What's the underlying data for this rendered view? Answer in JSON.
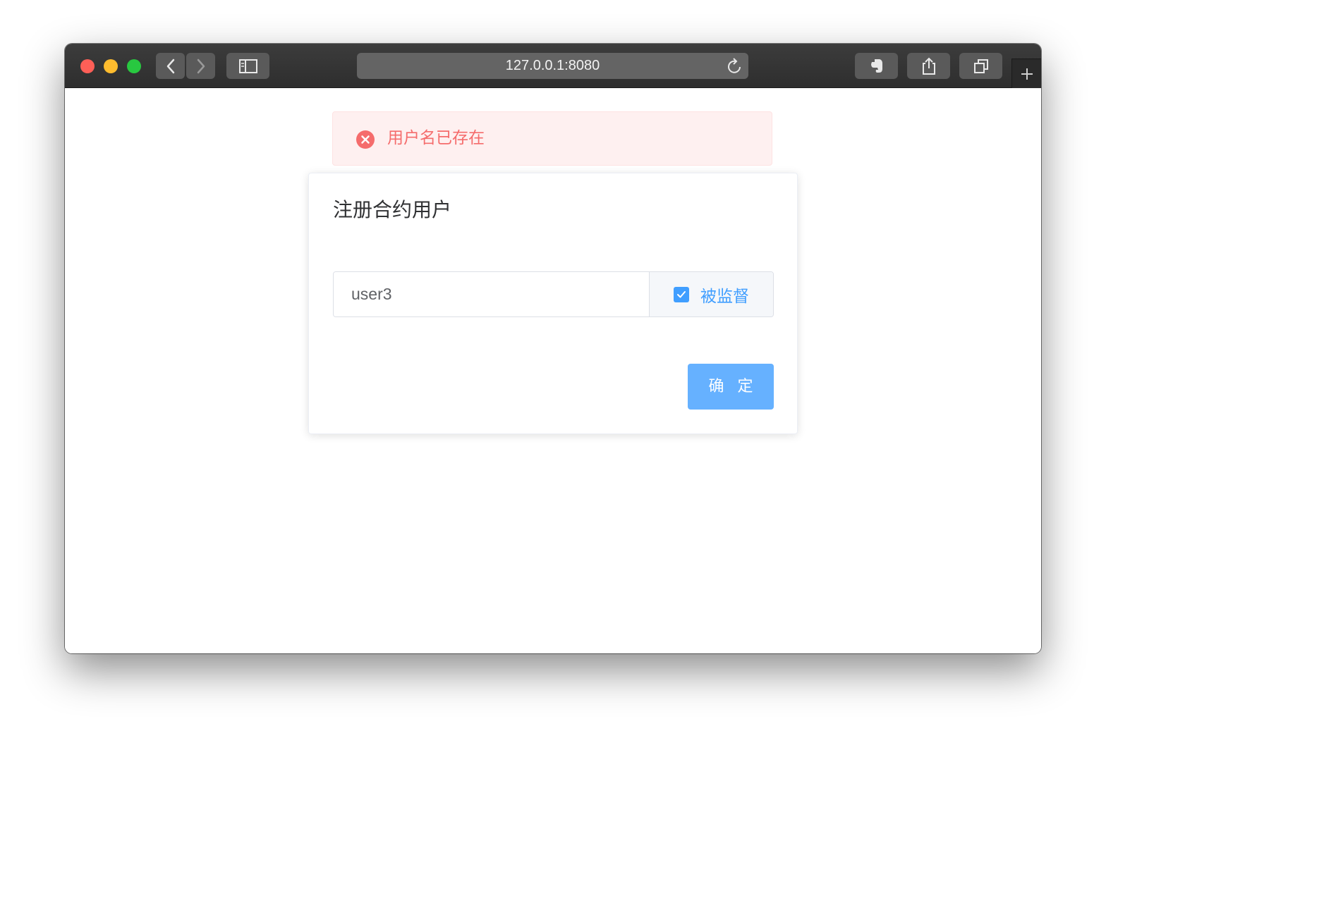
{
  "browser": {
    "url": "127.0.0.1:8080",
    "colors": {
      "close": "#fe5f57",
      "minimize": "#febc2e",
      "zoom": "#28c840"
    },
    "icons": {
      "back": "chevron-left-icon",
      "forward": "chevron-right-icon",
      "sidebar": "sidebar-icon",
      "reload": "reload-icon",
      "evernote": "evernote-icon",
      "share": "share-icon",
      "tabs": "tab-overview-icon",
      "new_tab": "plus-icon"
    }
  },
  "alert": {
    "type": "error",
    "message": "用户名已存在",
    "icon": "error-circle-icon",
    "colors": {
      "text": "#f56c6c",
      "background": "#fef0f0"
    }
  },
  "card": {
    "title": "注册合约用户",
    "username": {
      "value": "user3"
    },
    "supervised": {
      "label": "被监督",
      "checked": true
    },
    "confirm_label": "确 定",
    "colors": {
      "primary": "#409eff",
      "button": "#66b1ff"
    }
  }
}
